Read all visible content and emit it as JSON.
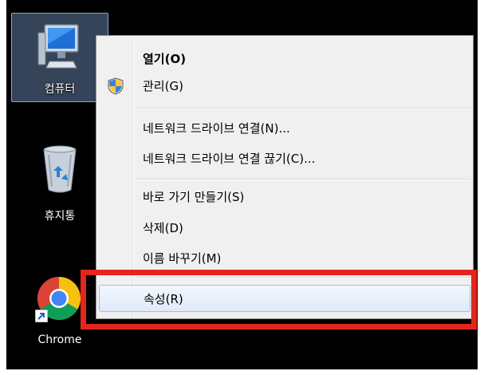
{
  "desktop": {
    "icons": [
      {
        "label": "컴퓨터",
        "icon": "computer-icon"
      },
      {
        "label": "휴지통",
        "icon": "recycle-bin-icon"
      },
      {
        "label": "Chrome",
        "icon": "chrome-icon"
      }
    ]
  },
  "context_menu": {
    "items": [
      {
        "label": "열기(O)",
        "bold": true
      },
      {
        "label": "관리(G)",
        "icon": "uac-shield-icon"
      },
      {
        "label": "네트워크 드라이브 연결(N)..."
      },
      {
        "label": "네트워크 드라이브 연결 끊기(C)..."
      },
      {
        "label": "바로 가기 만들기(S)"
      },
      {
        "label": "삭제(D)"
      },
      {
        "label": "이름 바꾸기(M)"
      },
      {
        "label": "속성(R)",
        "highlighted": true
      }
    ]
  },
  "colors": {
    "annotation": "#e2261a",
    "desktop_background": "#000000",
    "menu_background": "#f0f0f0",
    "highlight_border": "#9fbfe6"
  }
}
